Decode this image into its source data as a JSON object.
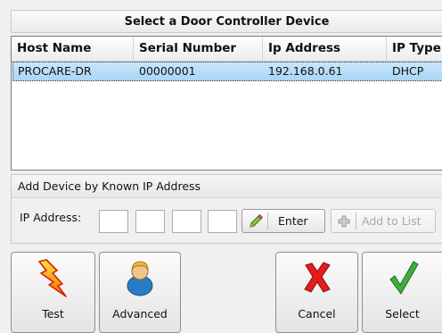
{
  "title": "Select a Door Controller Device",
  "table": {
    "headers": [
      "Host Name",
      "Serial Number",
      "Ip Address",
      "IP Type"
    ],
    "rows": [
      [
        "PROCARE-DR",
        "00000001",
        "192.168.0.61",
        "DHCP"
      ]
    ]
  },
  "add_section": {
    "header": "Add Device by Known IP Address",
    "ip_label": "IP Address:",
    "octets": [
      "",
      "",
      "",
      ""
    ],
    "enter_label": "Enter",
    "add_to_list_label": "Add to List"
  },
  "buttons": {
    "test": "Test",
    "advanced": "Advanced",
    "cancel": "Cancel",
    "select": "Select"
  },
  "colors": {
    "selected_row": "#b4dbf7",
    "cancel_icon": "#e31c1c",
    "select_icon": "#2f9b2f",
    "test_icon": "#ff8a00"
  }
}
